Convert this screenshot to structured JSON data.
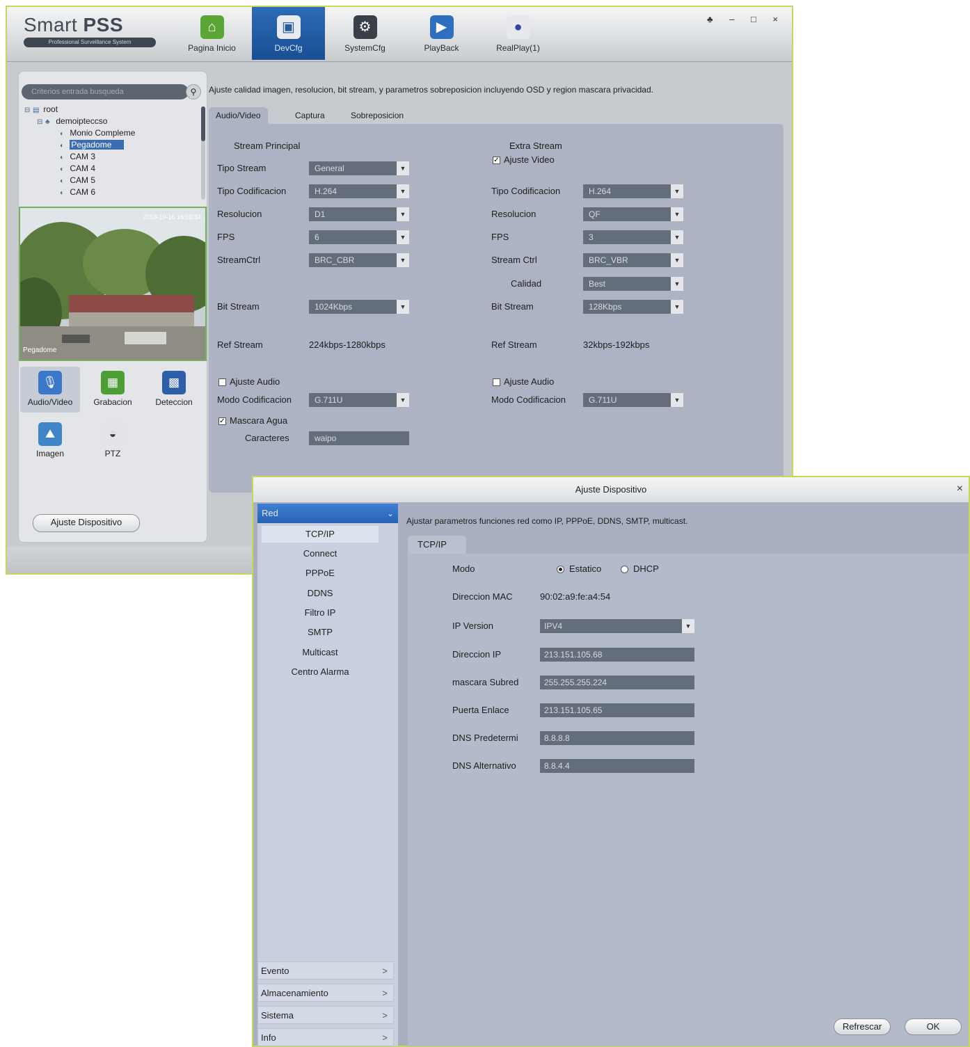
{
  "app": {
    "logo_title_a": "Smart ",
    "logo_title_b": "PSS",
    "logo_subtitle": "Professional Surveillance System"
  },
  "nav": {
    "tabs": [
      {
        "label": "Pagina Inicio",
        "icon": "home-icon"
      },
      {
        "label": "DevCfg",
        "icon": "camera-config-icon"
      },
      {
        "label": "SystemCfg",
        "icon": "gears-icon"
      },
      {
        "label": "PlayBack",
        "icon": "film-play-icon"
      },
      {
        "label": "RealPlay(1)",
        "icon": "record-icon"
      }
    ],
    "window_controls": "♣ – □ ×"
  },
  "left": {
    "search_placeholder": "Criterios entrada busqueda",
    "tree": [
      "root",
      "demoipteccso",
      "Monio Compleme",
      "Pegadome",
      "CAM 3",
      "CAM 4",
      "CAM 5",
      "CAM 6"
    ],
    "preview_timestamp": "2013-10-16 16:08:34",
    "preview_caption": "Pegadome",
    "modules": [
      {
        "label": "Audio/Video",
        "icon": "microphone-icon"
      },
      {
        "label": "Grabacion",
        "icon": "film-camera-icon"
      },
      {
        "label": "Deteccion",
        "icon": "motion-detection-icon"
      },
      {
        "label": "Imagen",
        "icon": "landscape-image-icon"
      },
      {
        "label": "PTZ",
        "icon": "dome-camera-icon"
      }
    ],
    "ajuste_button": "Ajuste Dispositivo"
  },
  "content": {
    "description": "Ajuste calidad imagen, resolucion, bit stream, y parametros sobreposicion incluyendo OSD y region mascara privacidad.",
    "tabs": [
      "Audio/Video",
      "Captura",
      "Sobreposicion"
    ],
    "main_stream": {
      "heading": "Stream Principal",
      "tipo_stream_label": "Tipo Stream",
      "tipo_stream": "General",
      "tipo_codificacion_label": "Tipo Codificacion",
      "tipo_codificacion": "H.264",
      "resolucion_label": "Resolucion",
      "resolucion": "D1",
      "fps_label": "FPS",
      "fps": "6",
      "streamctrl_label": "StreamCtrl",
      "streamctrl": "BRC_CBR",
      "bitstream_label": "Bit Stream",
      "bitstream": "1024Kbps",
      "ref_stream_label": "Ref Stream",
      "ref_stream": "224kbps-1280kbps",
      "ajuste_audio_label": "Ajuste Audio",
      "modo_cod_label": "Modo Codificacion",
      "modo_cod": "G.711U",
      "mascara_label": "Mascara Agua",
      "caracteres_label": "Caracteres",
      "caracteres": "waipo"
    },
    "extra_stream": {
      "heading": "Extra Stream",
      "ajuste_video_label": "Ajuste Video",
      "tipo_codificacion_label": "Tipo Codificacion",
      "tipo_codificacion": "H.264",
      "resolucion_label": "Resolucion",
      "resolucion": "QF",
      "fps_label": "FPS",
      "fps": "3",
      "streamctrl_label": "Stream Ctrl",
      "streamctrl": "BRC_VBR",
      "calidad_label": "Calidad",
      "calidad": "Best",
      "bitstream_label": "Bit Stream",
      "bitstream": "128Kbps",
      "ref_stream_label": "Ref Stream",
      "ref_stream": "32kbps-192kbps",
      "ajuste_audio_label": "Ajuste Audio",
      "modo_cod_label": "Modo Codificacion",
      "modo_cod": "G.711U"
    }
  },
  "dialog": {
    "title": "Ajuste Dispositivo",
    "close": "×",
    "side_header": "Red",
    "side_chev": "⌄",
    "side_items": [
      "TCP/IP",
      "Connect",
      "PPPoE",
      "DDNS",
      "Filtro IP",
      "SMTP",
      "Multicast",
      "Centro Alarma"
    ],
    "side_groups": [
      "Evento",
      "Almacenamiento",
      "Sistema",
      "Info"
    ],
    "description": "Ajustar parametros funciones red como IP, PPPoE, DDNS, SMTP, multicast.",
    "tab": "TCP/IP",
    "modo_label": "Modo",
    "modo_estatico": "Estatico",
    "modo_dhcp": "DHCP",
    "mac_label": "Direccion MAC",
    "mac": "90:02:a9:fe:a4:54",
    "ipversion_label": "IP Version",
    "ipversion": "IPV4",
    "ip_label": "Direccion IP",
    "ip": "213.151.105.68",
    "mask_label": "mascara Subred",
    "mask": "255.255.255.224",
    "gateway_label": "Puerta Enlace",
    "gateway": "213.151.105.65",
    "dns1_label": "DNS Predetermi",
    "dns1": "8.8.8.8",
    "dns2_label": "DNS Alternativo",
    "dns2": "8.8.4.4",
    "refresh_button": "Refrescar",
    "ok_button": "OK"
  }
}
